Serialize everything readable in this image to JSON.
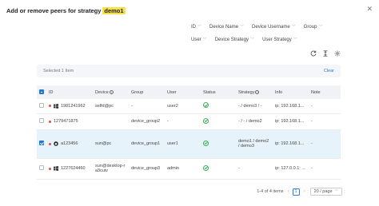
{
  "dialog": {
    "title": "Add or remove peers for strategy",
    "strategy_badge": "demo1",
    "close_glyph": "✕"
  },
  "filters_row1": [
    {
      "label": "ID"
    },
    {
      "label": "Device Name"
    },
    {
      "label": "Device Username"
    },
    {
      "label": "Group"
    }
  ],
  "filters_row2": [
    {
      "label": "User"
    },
    {
      "label": "Device Strategy"
    },
    {
      "label": "User Strategy"
    }
  ],
  "toolbar": {
    "refresh_icon": "refresh-icon",
    "column_height_icon": "column-height-icon",
    "settings_icon": "settings-icon"
  },
  "selection": {
    "text": "Selected  1  Item",
    "clear_label": "Clear"
  },
  "table": {
    "headers": {
      "id": "ID",
      "device": "Device",
      "group": "Group",
      "user": "User",
      "status": "Status",
      "strategy": "Strategy",
      "info": "Info",
      "note": "Note"
    },
    "rows": [
      {
        "checked": false,
        "os": "windows",
        "id": "1981241962",
        "device": "selfd@pc",
        "group": "-",
        "user": "user2",
        "status": "online",
        "strategy": "- / demo3 / -",
        "info": "ip: 192.168.1...",
        "note": "-"
      },
      {
        "checked": false,
        "os": "none",
        "id": "1279471875",
        "device": "",
        "group": "device_group2",
        "user": "-",
        "status": "online",
        "strategy": "- / - / demo2",
        "info": "ip: 192.168.1...",
        "note": "-"
      },
      {
        "checked": true,
        "os": "linux",
        "id": "a123456",
        "device": "sun@pc",
        "group": "device_group1",
        "user": "user1",
        "status": "online",
        "strategy": "demo1 / demo2 / demo3",
        "info": "ip: 192.168.1...",
        "note": "-"
      },
      {
        "checked": false,
        "os": "windows",
        "id": "1227624460",
        "device": "sun@desktop-ra3cuiv",
        "group": "device_group3",
        "user": "admin",
        "status": "online",
        "strategy": "-",
        "info": "ip: 127.0.0.1: ...",
        "note": "-"
      }
    ]
  },
  "pagination": {
    "range_text": "1-4 of 4 items",
    "prev": "‹",
    "current_page": "1",
    "next": "›",
    "page_size": "20 / page"
  },
  "colors": {
    "accent": "#1e78d6",
    "offline_dot": "#e24b4b",
    "online_check": "#3db05c",
    "badge": "#f7e04a"
  }
}
